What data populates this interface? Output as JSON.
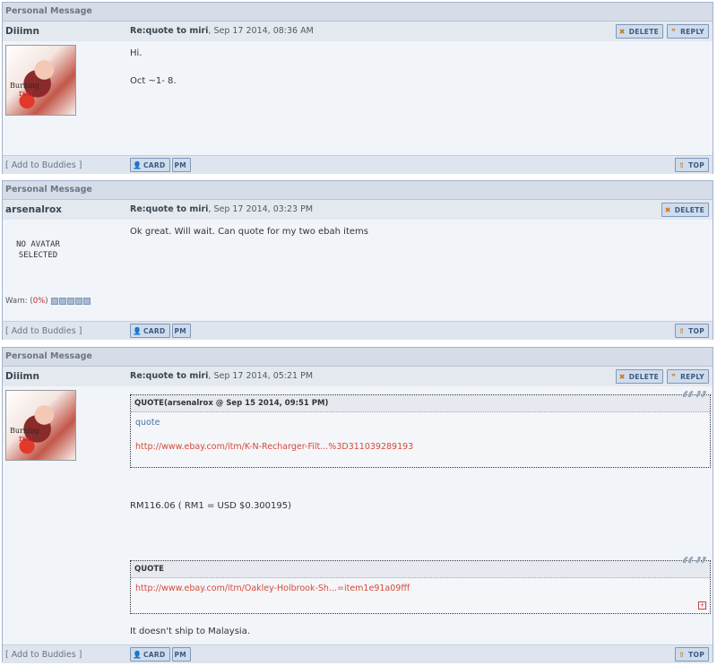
{
  "common": {
    "section_title": "Personal Message",
    "delete_label": "DELETE",
    "reply_label": "REPLY",
    "card_label": "CARD",
    "pm_label": "PM",
    "top_label": "TOP",
    "add_buddies": "[ Add to Buddies ]"
  },
  "posts": [
    {
      "author": "Diiimn",
      "subject": "Re:quote to miri",
      "date": ", Sep 17 2014, 08:36 AM",
      "avatar_text_1": "Burning",
      "avatar_text_2": "red",
      "lines": [
        "Hi.",
        "Oct ~1- 8."
      ]
    },
    {
      "author": "arsenalrox",
      "subject": "Re:quote to miri",
      "date": ", Sep 17 2014, 03:23 PM",
      "no_avatar_1": "NO AVATAR",
      "no_avatar_2": "SELECTED",
      "warn_label": "Warn: (",
      "warn_pct": "0%",
      "warn_close": ")",
      "lines": [
        "Ok great. Will wait. Can quote for my two ebah items"
      ]
    },
    {
      "author": "Diiimn",
      "subject": "Re:quote to miri",
      "date": ", Sep 17 2014, 05:21 PM",
      "avatar_text_1": "Burning",
      "avatar_text_2": "red",
      "quote1": {
        "title": "QUOTE(arsenalrox @ Sep 15 2014, 09:51 PM)",
        "line1": "quote",
        "link": "http://www.ebay.com/itm/K-N-Recharger-Filt...%3D311039289193"
      },
      "price_line": "RM116.06 ( RM1 = USD $0.300195)",
      "quote2": {
        "title": "QUOTE",
        "link": "http://www.ebay.com/itm/Oakley-Holbrook-Sh...=item1e91a09fff"
      },
      "closing_line": "It doesn't ship to Malaysia."
    }
  ]
}
